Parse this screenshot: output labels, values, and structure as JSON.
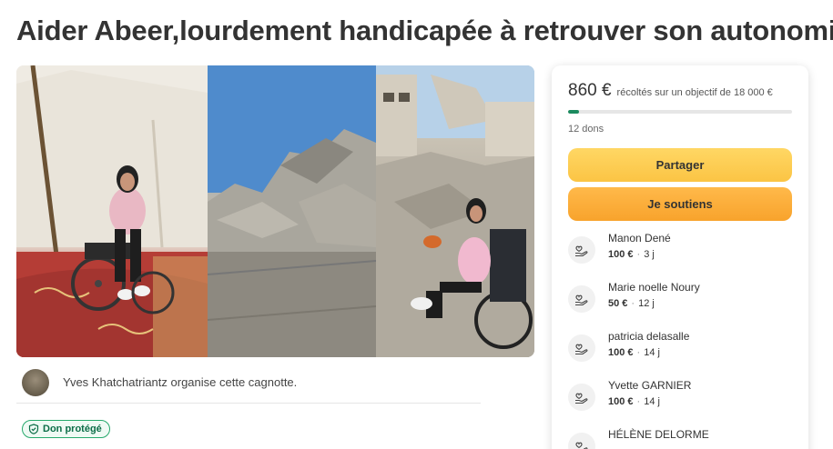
{
  "page": {
    "title": "Aider Abeer,lourdement handicapée à retrouver son autonomie"
  },
  "organizer": {
    "text": "Yves Khatchatriantz organise cette cagnotte."
  },
  "badge": {
    "label": "Don protégé",
    "color": "#26a96c"
  },
  "campaign": {
    "amount": "860 €",
    "goal_text": "récoltés sur un objectif de 18 000 €",
    "progress_fraction": 0.048,
    "donation_count": "12 dons",
    "accent_color": "#1b8a5e"
  },
  "buttons": {
    "share": "Partager",
    "support": "Je soutiens"
  },
  "donors": [
    {
      "name": "Manon Dené",
      "amount": "100 €",
      "time": "3 j"
    },
    {
      "name": "Marie noelle Noury",
      "amount": "50 €",
      "time": "12 j"
    },
    {
      "name": "patricia delasalle",
      "amount": "100 €",
      "time": "14 j"
    },
    {
      "name": "Yvette GARNIER",
      "amount": "100 €",
      "time": "14 j"
    },
    {
      "name": "HÉLÈNE DELORME",
      "amount": "",
      "time": ""
    }
  ],
  "icons": {
    "donor": "heart-hand-icon",
    "badge": "shield-check-icon"
  }
}
